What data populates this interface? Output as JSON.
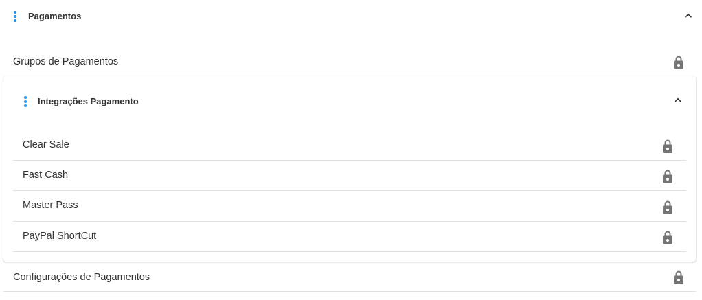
{
  "accent_color": "#2196F3",
  "icon_color": "#757575",
  "pagamentos": {
    "title": "Pagamentos",
    "menu_icon": "more-vert-icon",
    "collapse_icon": "chevron-up-icon"
  },
  "grupos": {
    "label": "Grupos de Pagamentos",
    "lock_icon": "lock-icon"
  },
  "integracoes": {
    "title": "Integrações Pagamento",
    "menu_icon": "more-vert-icon",
    "collapse_icon": "chevron-up-icon",
    "items": [
      {
        "label": "Clear Sale",
        "icon": "lock-icon"
      },
      {
        "label": "Fast Cash",
        "icon": "lock-icon"
      },
      {
        "label": "Master Pass",
        "icon": "lock-icon"
      },
      {
        "label": "PayPal ShortCut",
        "icon": "lock-icon"
      }
    ]
  },
  "configuracoes": {
    "label": "Configurações de Pagamentos",
    "lock_icon": "lock-icon"
  }
}
